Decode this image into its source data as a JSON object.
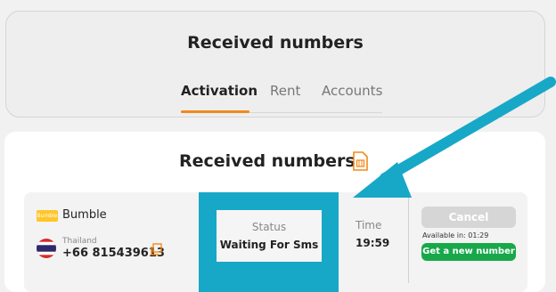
{
  "header": {
    "title": "Received numbers",
    "tabs": [
      {
        "label": "Activation",
        "active": true
      },
      {
        "label": "Rent",
        "active": false
      },
      {
        "label": "Accounts",
        "active": false
      }
    ]
  },
  "main": {
    "title": "Received numbers",
    "icon": "sim-card-icon",
    "row": {
      "service": {
        "logo_text": "Bumble",
        "name": "Bumble"
      },
      "country": "Thailand",
      "phone": "+66 815439613",
      "status_label": "Status",
      "status_value": "Waiting For Sms",
      "time_label": "Time",
      "time_value": "19:59",
      "cancel_label": "Cancel",
      "available_text": "Available in: 01:29",
      "new_number_label": "Get a new number"
    }
  },
  "colors": {
    "accent": "#f08a1d",
    "highlight": "#18a8c7",
    "success": "#17a84a",
    "disabled": "#d6d6d6"
  }
}
